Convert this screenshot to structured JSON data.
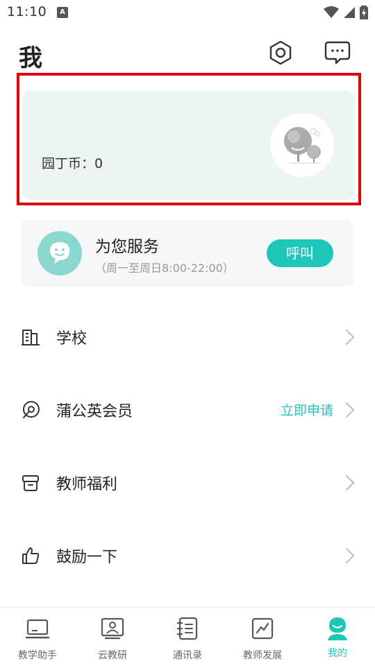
{
  "status_bar": {
    "time": "11:10",
    "notification_glyph": "A"
  },
  "header": {
    "title": "我",
    "settings_icon": "hexagon-settings-icon",
    "message_icon": "chat-bubble-icon"
  },
  "coin_card": {
    "label": "园丁币：0"
  },
  "service": {
    "title": "为您服务",
    "hours": "（周一至周日8:00-22:00）",
    "call_label": "呼叫"
  },
  "menu": {
    "items": [
      {
        "label": "学校",
        "icon": "building-icon",
        "action": ""
      },
      {
        "label": "蒲公英会员",
        "icon": "member-badge-icon",
        "action": "立即申请"
      },
      {
        "label": "教师福利",
        "icon": "gift-box-icon",
        "action": ""
      },
      {
        "label": "鼓励一下",
        "icon": "thumbs-up-icon",
        "action": ""
      }
    ]
  },
  "bottom_nav": {
    "items": [
      {
        "label": "教学助手",
        "icon": "laptop-icon",
        "active": false
      },
      {
        "label": "云教研",
        "icon": "teacher-board-icon",
        "active": false
      },
      {
        "label": "通讯录",
        "icon": "contacts-book-icon",
        "active": false
      },
      {
        "label": "教师发展",
        "icon": "growth-chart-icon",
        "active": false
      },
      {
        "label": "我的",
        "icon": "profile-icon",
        "active": true
      }
    ]
  },
  "colors": {
    "accent": "#1ec6b8",
    "highlight": "#e00000",
    "card_bg": "#edf5f4",
    "service_bg": "#f5f7f8"
  }
}
